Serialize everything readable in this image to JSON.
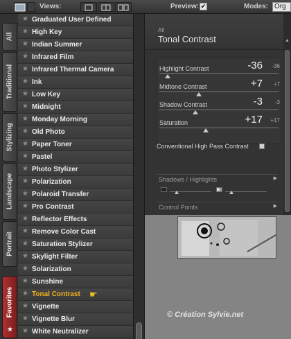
{
  "toolbar": {
    "views_label": "Views:",
    "preview_label": "Preview:",
    "preview_checked_mark": "✔",
    "modes_label": "Modes:",
    "modes_value": "Org"
  },
  "category_tabs": [
    {
      "label": "All"
    },
    {
      "label": "Traditional"
    },
    {
      "label": "Stylizing"
    },
    {
      "label": "Landscape"
    },
    {
      "label": "Portrait"
    },
    {
      "label": "Favorites"
    }
  ],
  "filters": [
    {
      "label": "Graduated User Defined"
    },
    {
      "label": "High Key"
    },
    {
      "label": "Indian Summer"
    },
    {
      "label": "Infrared Film"
    },
    {
      "label": "Infrared Thermal Camera"
    },
    {
      "label": "Ink"
    },
    {
      "label": "Low Key"
    },
    {
      "label": "Midnight"
    },
    {
      "label": "Monday Morning"
    },
    {
      "label": "Old Photo"
    },
    {
      "label": "Paper Toner"
    },
    {
      "label": "Pastel"
    },
    {
      "label": "Photo Stylizer"
    },
    {
      "label": "Polarization"
    },
    {
      "label": "Polaroid Transfer"
    },
    {
      "label": "Pro Contrast"
    },
    {
      "label": "Reflector Effects"
    },
    {
      "label": "Remove Color Cast"
    },
    {
      "label": "Saturation Stylizer"
    },
    {
      "label": "Skylight Filter"
    },
    {
      "label": "Solarization"
    },
    {
      "label": "Sunshine"
    },
    {
      "label": "Tonal Contrast",
      "selected": true
    },
    {
      "label": "Vignette"
    },
    {
      "label": "Vignette Blur"
    },
    {
      "label": "White Neutralizer"
    }
  ],
  "panel": {
    "breadcrumb": "All",
    "title": "Tonal Contrast",
    "sliders": [
      {
        "name": "Highlight Contrast",
        "value": "-36",
        "small": "-36",
        "level": 0.07
      },
      {
        "name": "Midtone Contrast",
        "value": "+7",
        "small": "+7",
        "level": 0.33
      },
      {
        "name": "Shadow Contrast",
        "value": "-3",
        "small": "-3",
        "level": 0.3
      },
      {
        "name": "Saturation",
        "value": "+17",
        "small": "+17",
        "level": 0.39
      }
    ],
    "checkbox_label": "Conventional High Pass Contrast",
    "sections": [
      {
        "label": "Shadows / Highlights"
      },
      {
        "label": "Control Points"
      }
    ]
  },
  "credit": "© Création Sylvie.net",
  "colors": {
    "selected_text": "#f2b01e",
    "favorites_tab": "#b03030"
  }
}
